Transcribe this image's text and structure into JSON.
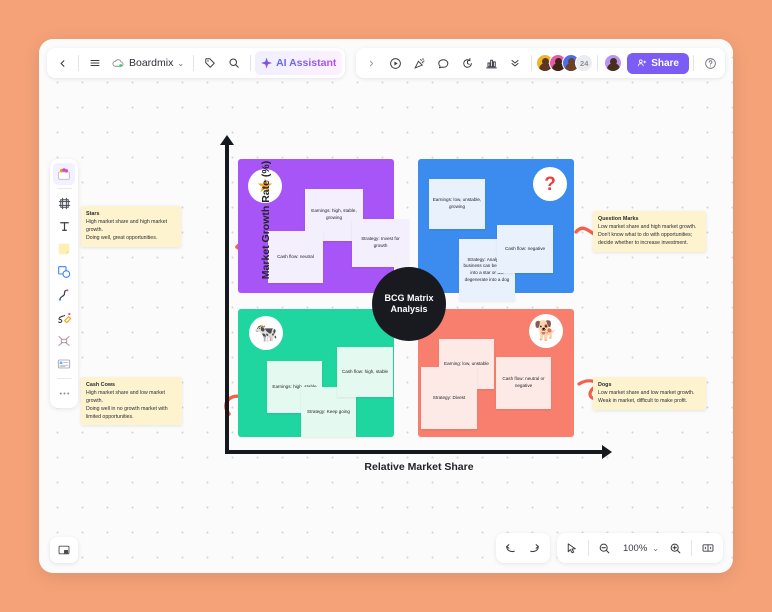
{
  "topbar": {
    "back_icon": "chevron-left-icon",
    "menu_icon": "hamburger-menu-icon",
    "doc_name": "Boardmix",
    "doc_caret": "⌄",
    "tag_icon": "tag-icon",
    "search_icon": "search-icon",
    "ai_label": "AI Assistant",
    "expand_icon": "chevron-right-icon",
    "present_icon": "play-circle-icon",
    "confetti_icon": "celebrate-icon",
    "comment_icon": "comment-bubble-icon",
    "timer_icon": "timer-icon",
    "chart_icon": "vote-chart-icon",
    "more_icon": "double-chevron-down-icon",
    "avatar_overflow": "24",
    "share_label": "Share",
    "share_icon": "person-add-icon",
    "help_icon": "question-circle-icon",
    "share_color": "#7b5cf5"
  },
  "tools": [
    {
      "name": "sticky-template-icon",
      "glyph": "template"
    },
    {
      "name": "frame-icon",
      "glyph": "frame"
    },
    {
      "name": "text-icon",
      "glyph": "T"
    },
    {
      "name": "sticky-note-icon",
      "glyph": "note"
    },
    {
      "name": "shapes-icon",
      "glyph": "shapes"
    },
    {
      "name": "curve-line-icon",
      "glyph": "curve"
    },
    {
      "name": "pen-icon",
      "glyph": "pen"
    },
    {
      "name": "connector-icon",
      "glyph": "connector"
    },
    {
      "name": "table-icon",
      "glyph": "table"
    },
    {
      "name": "more-tools-icon",
      "glyph": "dots"
    }
  ],
  "bottombar": {
    "minimap_icon": "minimap-icon",
    "undo_icon": "undo-arrow-icon",
    "redo_icon": "redo-arrow-icon",
    "cursor_icon": "pointer-cursor-icon",
    "zoom_out_icon": "zoom-out-icon",
    "zoom_level": "100%",
    "zoom_caret": "⌄",
    "zoom_in_icon": "zoom-in-icon",
    "fit_icon": "fit-to-screen-icon"
  },
  "chart_data": {
    "type": "matrix",
    "title": "BCG Matrix Analysis",
    "xlabel": "Relative Market Share",
    "ylabel": "Market Growth Rate (%)",
    "quadrants": [
      {
        "key": "stars",
        "title": "Stars",
        "badge": "★",
        "color": "#a855f7",
        "note_color": "#f3effc",
        "position": "top-left",
        "notes": [
          "Earnings: high, stable, growing",
          "Strategy: Invest for growth",
          "Cash flow: neutral"
        ],
        "callout_title": "Stars",
        "callout_body": "High market share and high market growth.\nDoing well, great opportunities."
      },
      {
        "key": "question-marks",
        "title": "Question Marks",
        "badge": "❓",
        "color": "#3c8cf0",
        "note_color": "#e9f1fd",
        "position": "top-right",
        "notes": [
          "Earnings: low, unstable, growing",
          "Strategy: Analyse if business can be grown into a star or will degenerate into a dog",
          "Cash flow: negative"
        ],
        "callout_title": "Question Marks",
        "callout_body": "Low market share and high market growth.\nDon't know what to do with opportunities;\ndecide whether to increase investment."
      },
      {
        "key": "cash-cows",
        "title": "Cash Cows",
        "badge": "🐄",
        "color": "#1fd6a0",
        "note_color": "#e4faf0",
        "position": "bottom-left",
        "notes": [
          "Earnings: high, stable",
          "Strategy: Keep going",
          "Cash flow: high, stable"
        ],
        "callout_title": "Cash Cows",
        "callout_body": "High market share and low market growth.\nDoing well in no growth market with limited opportunities."
      },
      {
        "key": "dogs",
        "title": "Dogs",
        "badge": "🐕",
        "color": "#f87f6e",
        "note_color": "#fdeae6",
        "position": "bottom-right",
        "notes": [
          "Earning: low, unstable",
          "Strategy: Divest",
          "Cash flow: neutral or negative"
        ],
        "callout_title": "Dogs",
        "callout_body": "Low market share and low market growth.\nWeak in market, difficult to make profit."
      }
    ]
  }
}
